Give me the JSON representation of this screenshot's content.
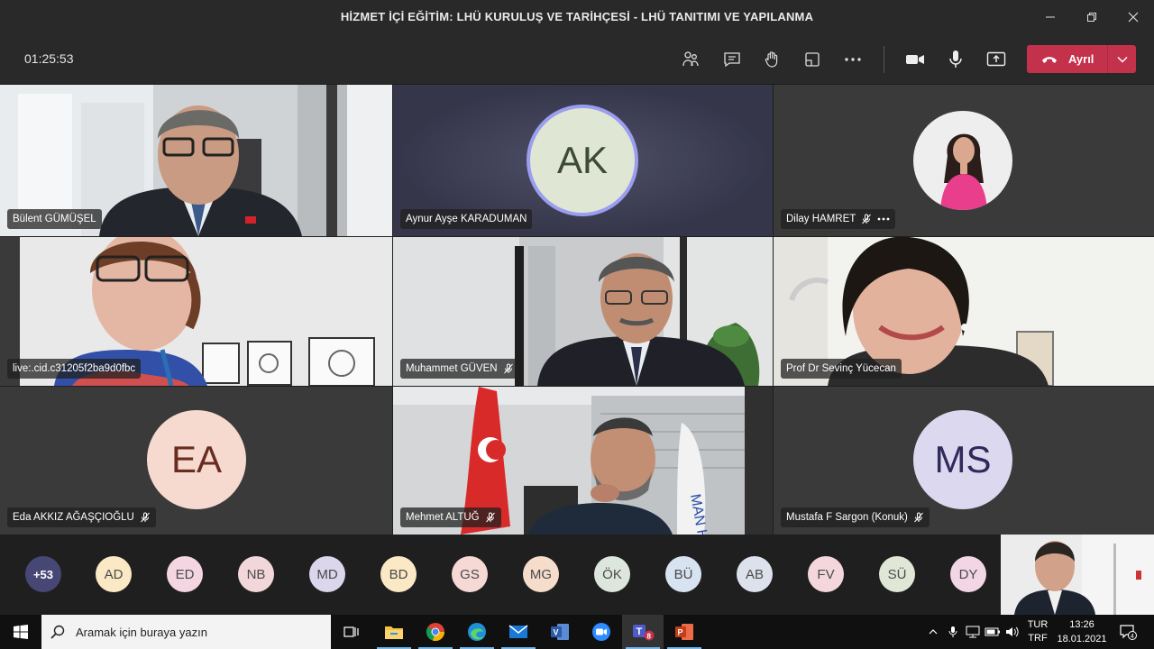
{
  "window": {
    "title": "HİZMET İÇİ EĞİTİM: LHÜ KURULUŞ VE TARİHÇESİ - LHÜ TANITIMI VE YAPILANMA"
  },
  "toolbar": {
    "timer": "01:25:53",
    "leave_label": "Ayrıl",
    "icons": [
      "people-icon",
      "chat-icon",
      "raise-hand-icon",
      "rooms-icon",
      "more-icon",
      "camera-icon",
      "mic-icon",
      "share-icon"
    ]
  },
  "tiles": [
    {
      "name": "Bülent GÜMÜŞEL",
      "muted": false
    },
    {
      "name": "Aynur Ayşe KARADUMAN",
      "initials": "AK",
      "muted": false
    },
    {
      "name": "Dilay HAMRET",
      "muted": true
    },
    {
      "name": "live:.cid.c31205f2ba9d0fbc",
      "muted": false
    },
    {
      "name": "Muhammet GÜVEN",
      "muted": true
    },
    {
      "name": "Prof Dr Sevinç Yücecan",
      "muted": false
    },
    {
      "name": "Eda AKKIZ AĞAŞÇIOĞLU",
      "initials": "EA",
      "muted": true
    },
    {
      "name": "Mehmet ALTUĞ",
      "muted": true
    },
    {
      "name": "Mustafa F Sargon (Konuk)",
      "initials": "MS",
      "muted": true
    }
  ],
  "participants": {
    "more": "+53",
    "chips": [
      {
        "initials": "AD",
        "color": "#fbe9c6"
      },
      {
        "initials": "ED",
        "color": "#f3d6e1"
      },
      {
        "initials": "NB",
        "color": "#f1d7d9"
      },
      {
        "initials": "MD",
        "color": "#dcd6ec"
      },
      {
        "initials": "BD",
        "color": "#fbe9c6"
      },
      {
        "initials": "GS",
        "color": "#f6d9d4"
      },
      {
        "initials": "MG",
        "color": "#f6dccb"
      },
      {
        "initials": "ÖK",
        "color": "#dde6dd"
      },
      {
        "initials": "BÜ",
        "color": "#d7e3f1"
      },
      {
        "initials": "AB",
        "color": "#dde1ec"
      },
      {
        "initials": "FV",
        "color": "#f4d7dd"
      },
      {
        "initials": "SÜ",
        "color": "#e0e7d6"
      },
      {
        "initials": "DY",
        "color": "#f3d6e6"
      }
    ]
  },
  "taskbar": {
    "search_placeholder": "Aramak için buraya yazın",
    "lang_top": "TUR",
    "lang_bottom": "TRF",
    "time": "13:26",
    "date": "18.01.2021",
    "notifications": "4",
    "teams_badge": "8"
  }
}
